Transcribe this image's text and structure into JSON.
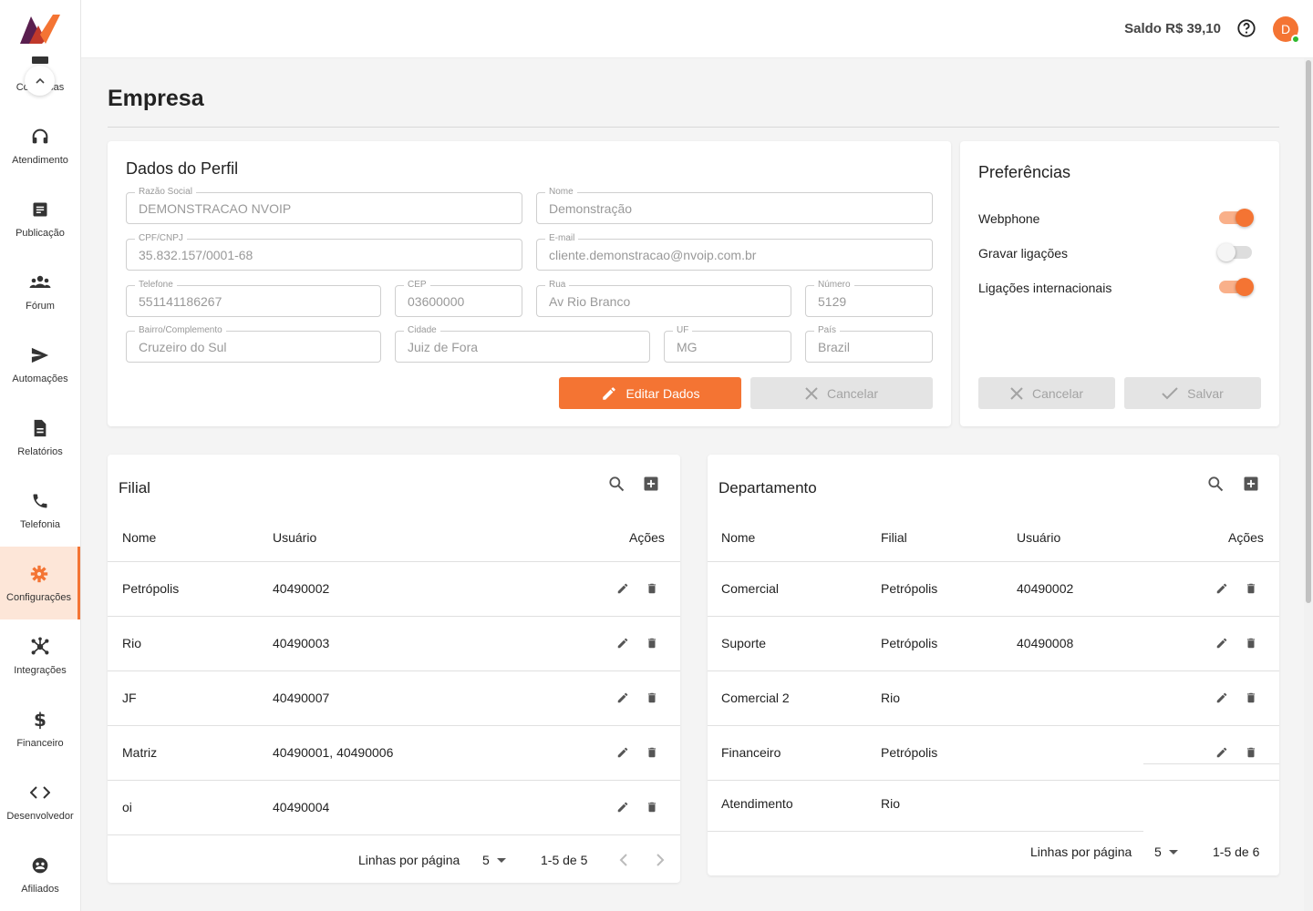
{
  "app": {
    "balance": "Saldo R$ 39,10",
    "avatar_initial": "D"
  },
  "sidebar": {
    "partial_label": "Conversas",
    "items": [
      {
        "label": "Atendimento",
        "icon": "headset-icon"
      },
      {
        "label": "Publicação",
        "icon": "article-icon"
      },
      {
        "label": "Fórum",
        "icon": "groups-icon"
      },
      {
        "label": "Automações",
        "icon": "send-icon"
      },
      {
        "label": "Relatórios",
        "icon": "report-icon"
      },
      {
        "label": "Telefonia",
        "icon": "phone-icon"
      },
      {
        "label": "Configurações",
        "icon": "gear-icon",
        "active": true
      },
      {
        "label": "Integrações",
        "icon": "hub-icon"
      },
      {
        "label": "Financeiro",
        "icon": "dollar-icon"
      },
      {
        "label": "Desenvolvedor",
        "icon": "code-icon"
      },
      {
        "label": "Afiliados",
        "icon": "affiliate-icon"
      }
    ]
  },
  "page": {
    "title": "Empresa"
  },
  "profile": {
    "heading": "Dados do Perfil",
    "fields": {
      "razao_social": {
        "label": "Razão Social",
        "value": "DEMONSTRACAO NVOIP"
      },
      "nome": {
        "label": "Nome",
        "value": "Demonstração"
      },
      "cpf_cnpj": {
        "label": "CPF/CNPJ",
        "value": "35.832.157/0001-68"
      },
      "email": {
        "label": "E-mail",
        "value": "cliente.demonstracao@nvoip.com.br"
      },
      "telefone": {
        "label": "Telefone",
        "value": "551141186267"
      },
      "cep": {
        "label": "CEP",
        "value": "03600000"
      },
      "rua": {
        "label": "Rua",
        "value": "Av Rio Branco"
      },
      "numero": {
        "label": "Número",
        "value": "5129"
      },
      "bairro": {
        "label": "Bairro/Complemento",
        "value": "Cruzeiro do Sul"
      },
      "cidade": {
        "label": "Cidade",
        "value": "Juiz de Fora"
      },
      "uf": {
        "label": "UF",
        "value": "MG"
      },
      "pais": {
        "label": "País",
        "value": "Brazil"
      }
    },
    "edit_label": "Editar Dados",
    "cancel_label": "Cancelar"
  },
  "preferences": {
    "heading": "Preferências",
    "items": [
      {
        "label": "Webphone",
        "on": true
      },
      {
        "label": "Gravar ligações",
        "on": false
      },
      {
        "label": "Ligações internacionais",
        "on": true
      }
    ],
    "cancel_label": "Cancelar",
    "save_label": "Salvar"
  },
  "filial": {
    "title": "Filial",
    "headers": {
      "nome": "Nome",
      "usuario": "Usuário",
      "acoes": "Ações"
    },
    "rows": [
      {
        "nome": "Petrópolis",
        "usuario": "40490002"
      },
      {
        "nome": "Rio",
        "usuario": "40490003"
      },
      {
        "nome": "JF",
        "usuario": "40490007"
      },
      {
        "nome": "Matriz",
        "usuario": "40490001, 40490006"
      },
      {
        "nome": "oi",
        "usuario": "40490004"
      }
    ],
    "pager": {
      "rows_label": "Linhas por página",
      "rows_value": "5",
      "range": "1-5 de 5"
    }
  },
  "departamento": {
    "title": "Departamento",
    "headers": {
      "nome": "Nome",
      "filial": "Filial",
      "usuario": "Usuário",
      "acoes": "Ações"
    },
    "rows": [
      {
        "nome": "Comercial",
        "filial": "Petrópolis",
        "usuario": "40490002"
      },
      {
        "nome": "Suporte",
        "filial": "Petrópolis",
        "usuario": "40490008"
      },
      {
        "nome": "Comercial 2",
        "filial": "Rio",
        "usuario": ""
      },
      {
        "nome": "Financeiro",
        "filial": "Petrópolis",
        "usuario": ""
      },
      {
        "nome": "Atendimento",
        "filial": "Rio",
        "usuario": ""
      }
    ],
    "pager": {
      "rows_label": "Linhas por página",
      "rows_value": "5",
      "range": "1-5 de 6"
    }
  },
  "colors": {
    "accent": "#f47433",
    "accent_light": "#fde6d8"
  }
}
